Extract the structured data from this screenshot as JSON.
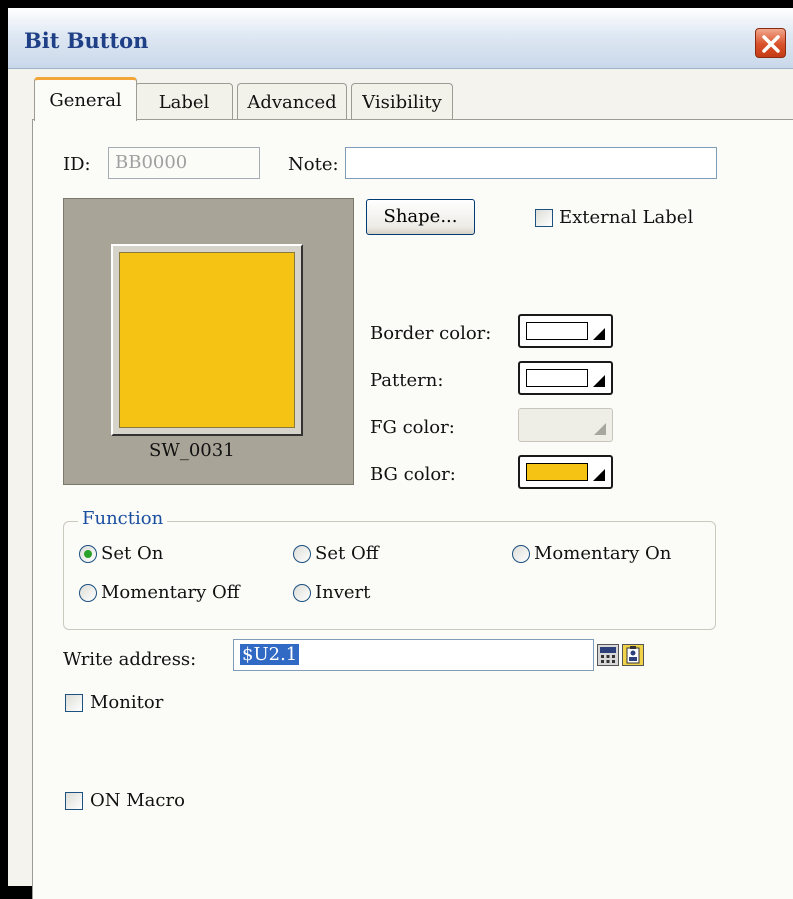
{
  "window": {
    "title": "Bit Button"
  },
  "tabs": [
    {
      "label": "General",
      "active": true
    },
    {
      "label": "Label",
      "active": false
    },
    {
      "label": "Advanced",
      "active": false
    },
    {
      "label": "Visibility",
      "active": false
    }
  ],
  "general": {
    "id_label": "ID:",
    "id_value": "BB0000",
    "note_label": "Note:",
    "note_value": "",
    "preview_shape_name": "SW_0031",
    "shape_button": "Shape...",
    "external_label": {
      "label": "External Label",
      "checked": false
    },
    "border_color": {
      "label": "Border color:",
      "color": "#ffffff"
    },
    "pattern": {
      "label": "Pattern:",
      "color": "#ffffff"
    },
    "fg_color": {
      "label": "FG color:",
      "enabled": false
    },
    "bg_color": {
      "label": "BG color:",
      "color": "#f5c313"
    },
    "function": {
      "legend": "Function",
      "options": [
        {
          "label": "Set On",
          "selected": true
        },
        {
          "label": "Set Off",
          "selected": false
        },
        {
          "label": "Momentary On",
          "selected": false
        },
        {
          "label": "Momentary Off",
          "selected": false
        },
        {
          "label": "Invert",
          "selected": false
        }
      ]
    },
    "write_address": {
      "label": "Write address:",
      "value": "$U2.1"
    },
    "monitor": {
      "label": "Monitor",
      "checked": false
    },
    "on_macro": {
      "label": "ON Macro",
      "checked": false
    }
  },
  "colors": {
    "title_text": "#1f3f86",
    "tab_highlight": "#f2a637",
    "bg_fill": "#f5c313",
    "selection": "#316ac5",
    "function_legend": "#1a4fa0"
  },
  "icons": {
    "close": "close-icon",
    "address_keypad": "calculator-icon",
    "address_browse": "address-book-icon"
  }
}
